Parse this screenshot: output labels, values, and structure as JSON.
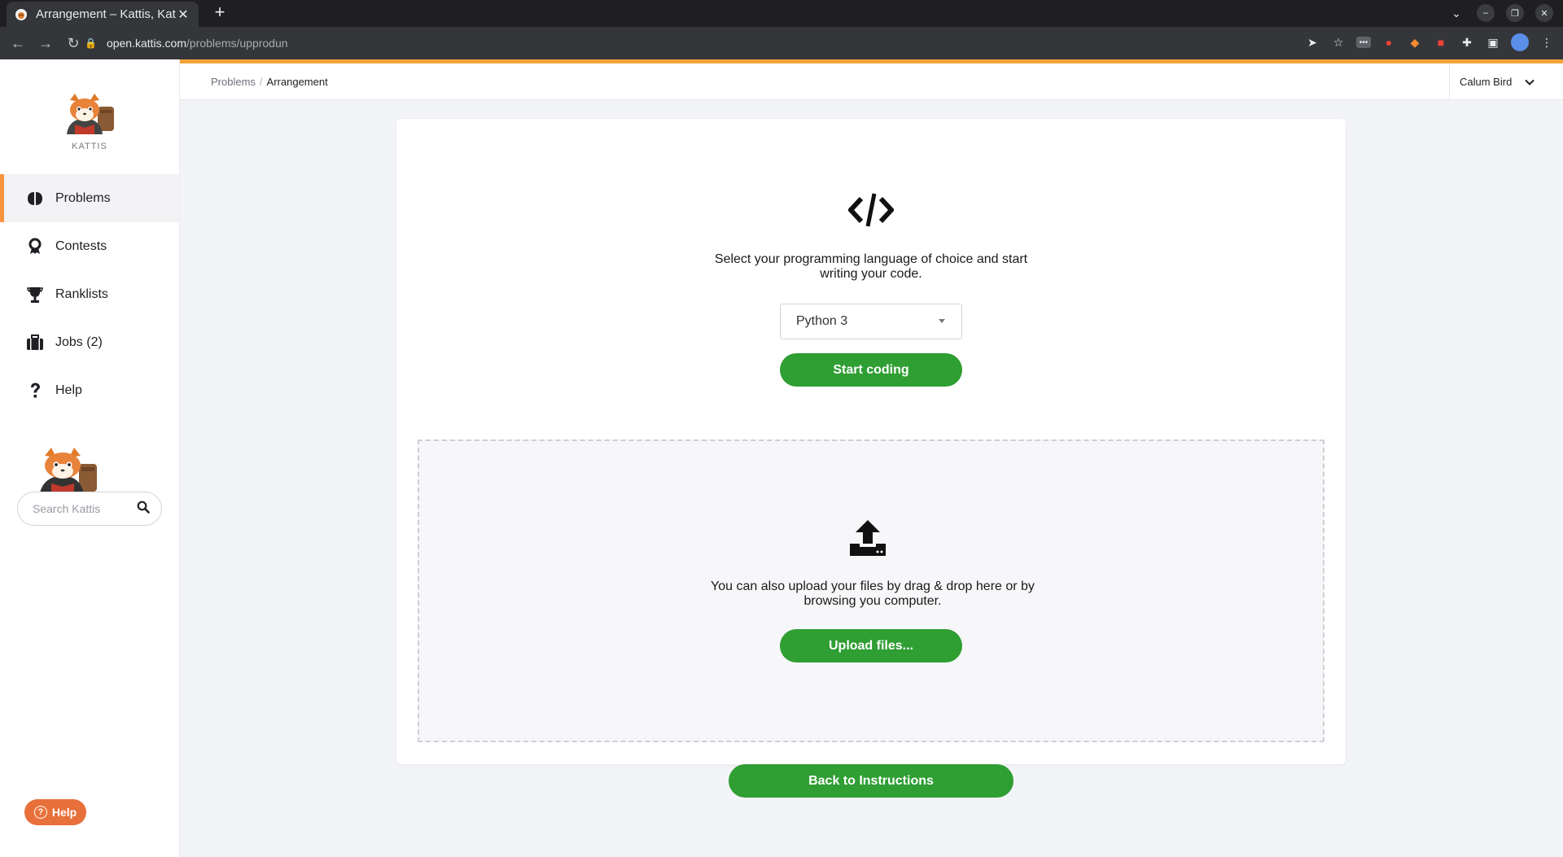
{
  "browser": {
    "tab_title": "Arrangement – Kattis, Kat",
    "tab_close": "✕",
    "new_tab": "+",
    "url_host": "open.kattis.com",
    "url_path": "/problems/upprodun"
  },
  "sidebar": {
    "logo_text": "KATTIS",
    "items": [
      {
        "label": "Problems",
        "icon": "brain-icon",
        "active": true
      },
      {
        "label": "Contests",
        "icon": "award-icon",
        "active": false
      },
      {
        "label": "Ranklists",
        "icon": "trophy-icon",
        "active": false
      },
      {
        "label": "Jobs (2)",
        "icon": "briefcase-icon",
        "active": false
      },
      {
        "label": "Help",
        "icon": "question-icon",
        "active": false
      }
    ],
    "search_placeholder": "Search Kattis",
    "help_button": "Help"
  },
  "header": {
    "breadcrumb": [
      "Problems",
      "Arrangement"
    ],
    "breadcrumb_sep": "/",
    "user_name": "Calum Bird"
  },
  "main": {
    "lang_prompt": "Select your programming language of choice and start writing your code.",
    "language_selected": "Python 3",
    "start_button": "Start coding",
    "upload_prompt": "You can also upload your files by drag & drop here or by browsing you computer.",
    "upload_button": "Upload files...",
    "back_button": "Back to Instructions"
  },
  "colors": {
    "accent_orange": "#f2a33a",
    "primary_green": "#2f9e33",
    "help_orange": "#e8703a"
  }
}
